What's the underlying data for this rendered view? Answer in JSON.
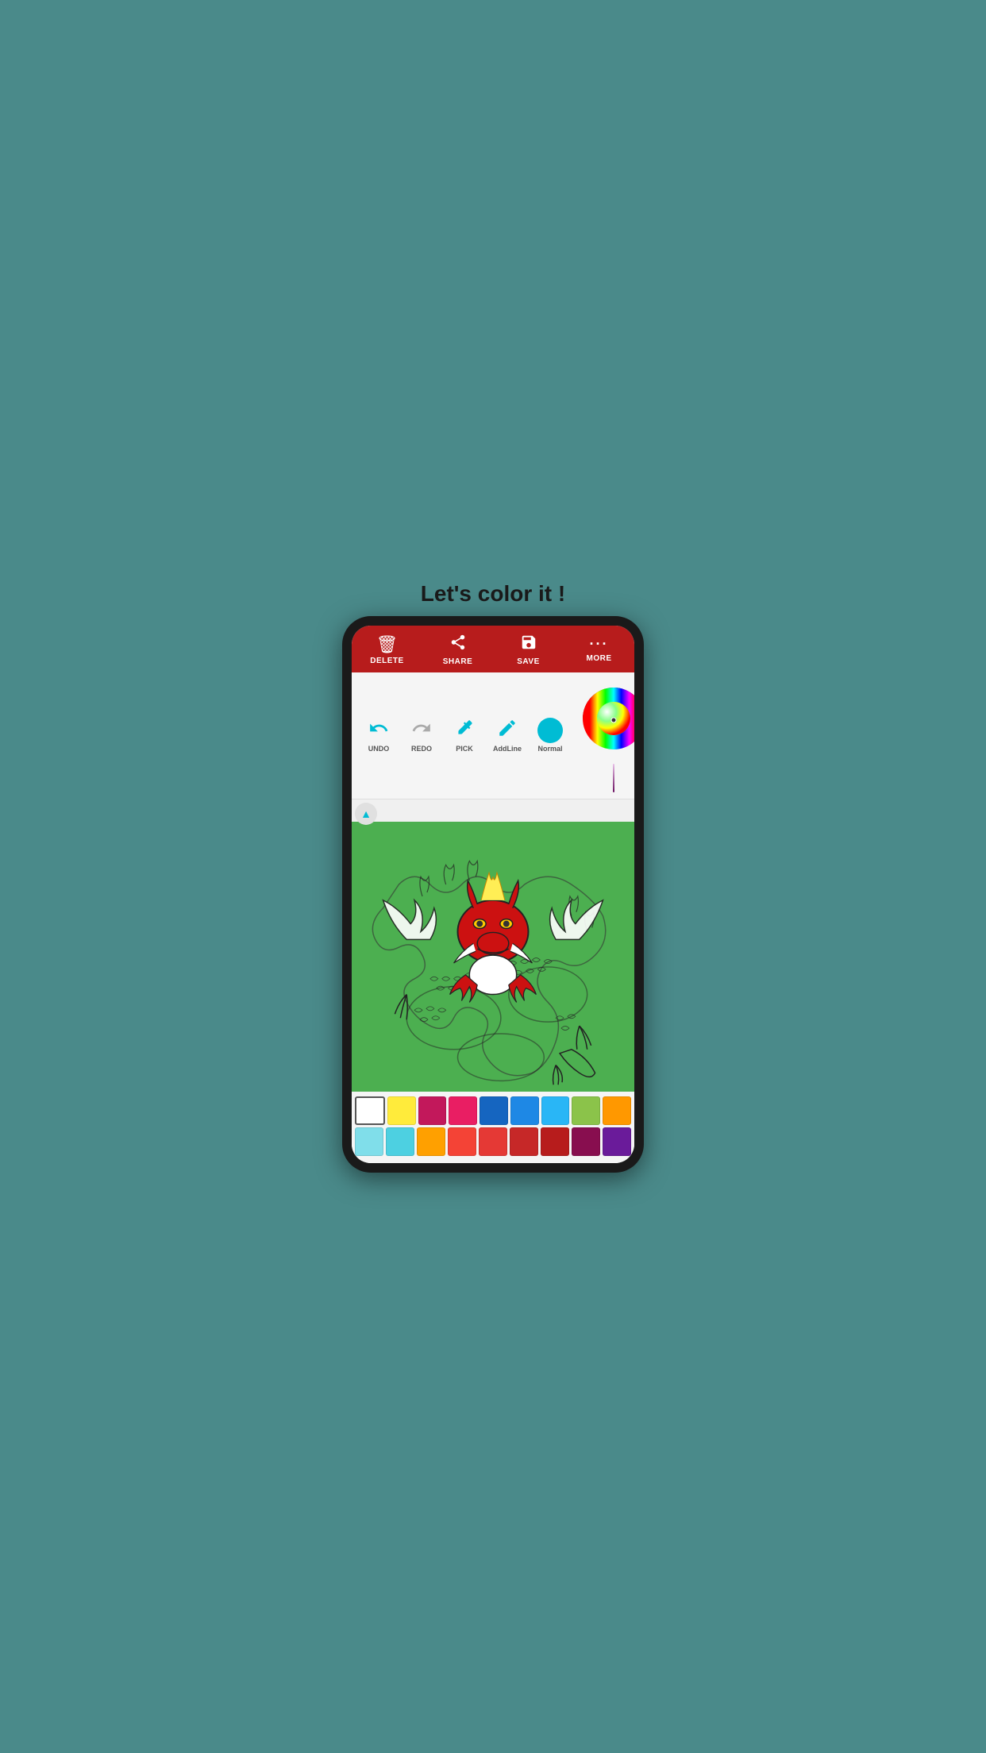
{
  "app": {
    "title": "Let's color it !"
  },
  "toolbar": {
    "items": [
      {
        "id": "delete",
        "label": "DELETE",
        "icon": "🗑"
      },
      {
        "id": "share",
        "label": "SHARE",
        "icon": "⬆"
      },
      {
        "id": "save",
        "label": "SAVE",
        "icon": "💾"
      },
      {
        "id": "more",
        "label": "MORE",
        "icon": "···"
      }
    ]
  },
  "drawing_toolbar": {
    "tools": [
      {
        "id": "undo",
        "label": "UNDO",
        "icon": "↩"
      },
      {
        "id": "redo",
        "label": "REDO",
        "icon": "↪"
      },
      {
        "id": "pick",
        "label": "PICK",
        "icon": "💉"
      },
      {
        "id": "addline",
        "label": "AddLine",
        "icon": "✏"
      },
      {
        "id": "normal",
        "label": "Normal"
      }
    ]
  },
  "color_palette": {
    "row1": [
      "#ffffff",
      "#ffeb3b",
      "#e91e8a",
      "#e91e63",
      "#1565c0",
      "#1e88e5",
      "#29b6f6",
      "#8bc34a",
      "#ff9800"
    ],
    "row2": [
      "#80deea",
      "#4dd0e1",
      "#ffa000",
      "#f44336",
      "#e53935",
      "#c62828",
      "#b71c1c",
      "#880e4f",
      "#6a1b9a"
    ]
  },
  "colors": {
    "background": "#4a8a8a",
    "toolbar_bg": "#b71c1c",
    "canvas_bg": "#4caf50",
    "accent": "#00bcd4"
  }
}
